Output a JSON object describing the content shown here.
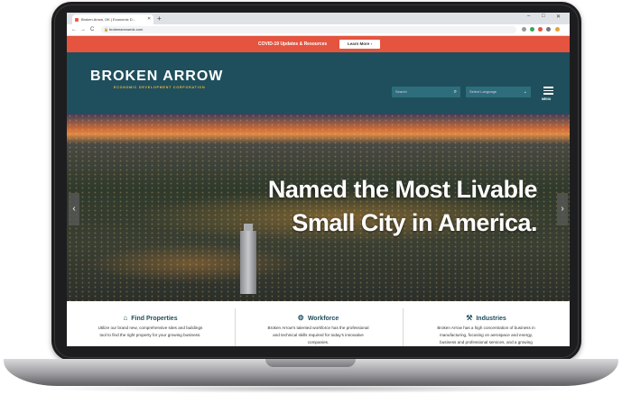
{
  "browser": {
    "tab_title": "Broken Arrow, OK | Economic D...",
    "tab_close": "✕",
    "new_tab": "+",
    "window_controls": [
      "–",
      "□",
      "✕"
    ],
    "back": "←",
    "forward": "→",
    "reload": "C",
    "url": "brokenarrowedc.com"
  },
  "banner": {
    "text": "COVID-19 Updates & Resources",
    "button": "Learn More ›",
    "color": "#e5543f"
  },
  "header": {
    "logo": "BROKEN ARROW",
    "logo_sub": "ECONOMIC DEVELOPMENT CORPORATION",
    "search_placeholder": "Search",
    "language_select": "Select Language",
    "menu_label": "MENU",
    "color": "#1f4f5c"
  },
  "hero": {
    "line1": "Named the Most Livable",
    "line2": "Small City in America.",
    "prev": "‹",
    "next": "›"
  },
  "cards": [
    {
      "icon": "find-properties-icon",
      "title": "Find Properties",
      "body": "Utilize our brand new, comprehensive sites and buildings tool to find the right property for your growing business."
    },
    {
      "icon": "workforce-icon",
      "title": "Workforce",
      "body": "Broken Arrow's talented workforce has the professional and technical skills required for today's innovative companies."
    },
    {
      "icon": "industries-icon",
      "title": "Industries",
      "body": "Broken Arrow has a high concentration of business in manufacturing, focusing on aerospace and energy, business and professional services, and a growing"
    }
  ]
}
